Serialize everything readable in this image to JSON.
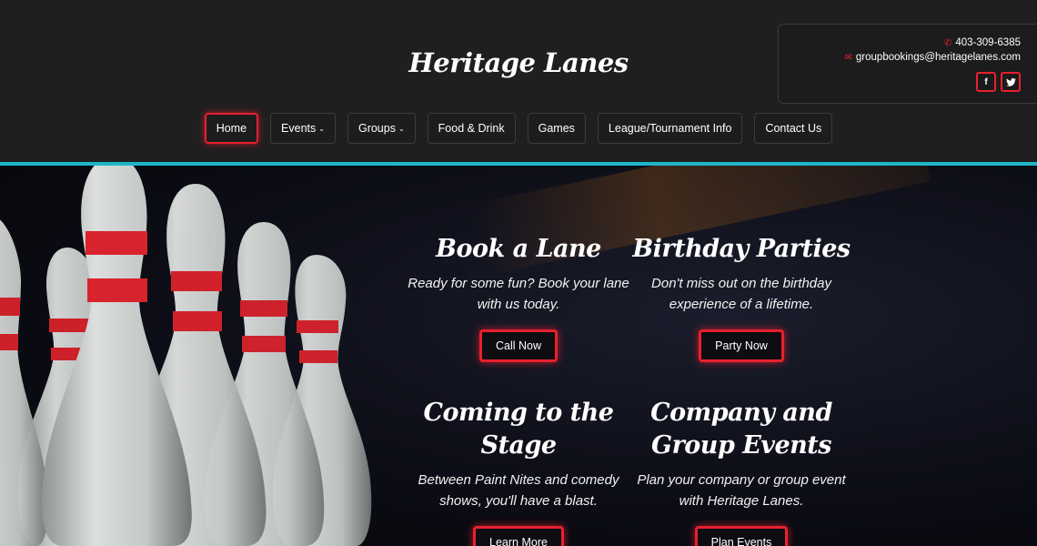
{
  "site": {
    "title": "Heritage Lanes"
  },
  "contact": {
    "phone": "403-309-6385",
    "email": "groupbookings@heritagelanes.com",
    "phone_icon": "phone-icon",
    "email_icon": "envelope-icon"
  },
  "socials": [
    {
      "name": "facebook-icon",
      "glyph": "f"
    },
    {
      "name": "twitter-icon",
      "glyph": "t"
    }
  ],
  "nav": {
    "items": [
      {
        "label": "Home",
        "active": true
      },
      {
        "label": "Events",
        "dropdown": true
      },
      {
        "label": "Groups",
        "dropdown": true
      },
      {
        "label": "Food & Drink"
      },
      {
        "label": "Games"
      },
      {
        "label": "League/Tournament Info"
      },
      {
        "label": "Contact Us"
      }
    ]
  },
  "cards": [
    {
      "title": "Book a Lane",
      "text": "Ready for some fun? Book your lane with us today.",
      "button": "Call Now"
    },
    {
      "title": "Birthday Parties",
      "text": "Don't miss out on the birthday experience of a lifetime.",
      "button": "Party Now"
    },
    {
      "title": "Coming to the Stage",
      "text": "Between Paint Nites and comedy shows, you'll have a blast.",
      "button": "Learn More"
    },
    {
      "title": "Company and Group Events",
      "text": "Plan your company or group event with Heritage Lanes.",
      "button": "Plan Events"
    }
  ],
  "colors": {
    "accent": "#e8202e",
    "teal": "#1fb6c9",
    "header_bg": "#1f1f1f"
  }
}
